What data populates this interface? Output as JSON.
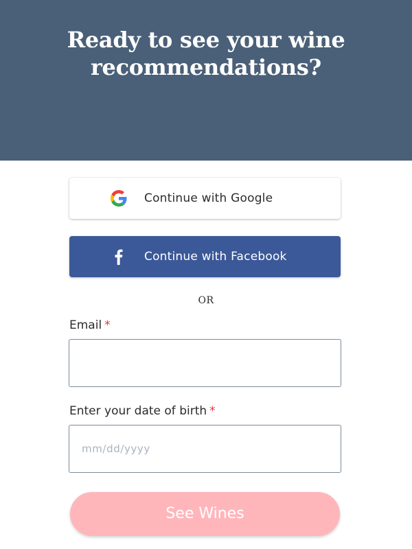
{
  "hero": {
    "title_line1": "Ready to see your wine",
    "title_line2": "recommendations?",
    "background_color": "#4a6078"
  },
  "social_login": {
    "google": {
      "label": "Continue with Google",
      "icon": "google-g-logo-icon"
    },
    "facebook": {
      "label": "Continue with Facebook",
      "icon": "facebook-f-icon",
      "background_color": "#3b5998"
    }
  },
  "separator": {
    "text": "OR"
  },
  "form": {
    "email": {
      "label": "Email",
      "required_marker": "*",
      "value": "",
      "placeholder": ""
    },
    "dob": {
      "label": "Enter your date of birth",
      "required_marker": "*",
      "value": "",
      "placeholder": "mm/dd/yyyy"
    },
    "submit": {
      "label": "See Wines",
      "background_color": "#ffb6bb"
    }
  }
}
